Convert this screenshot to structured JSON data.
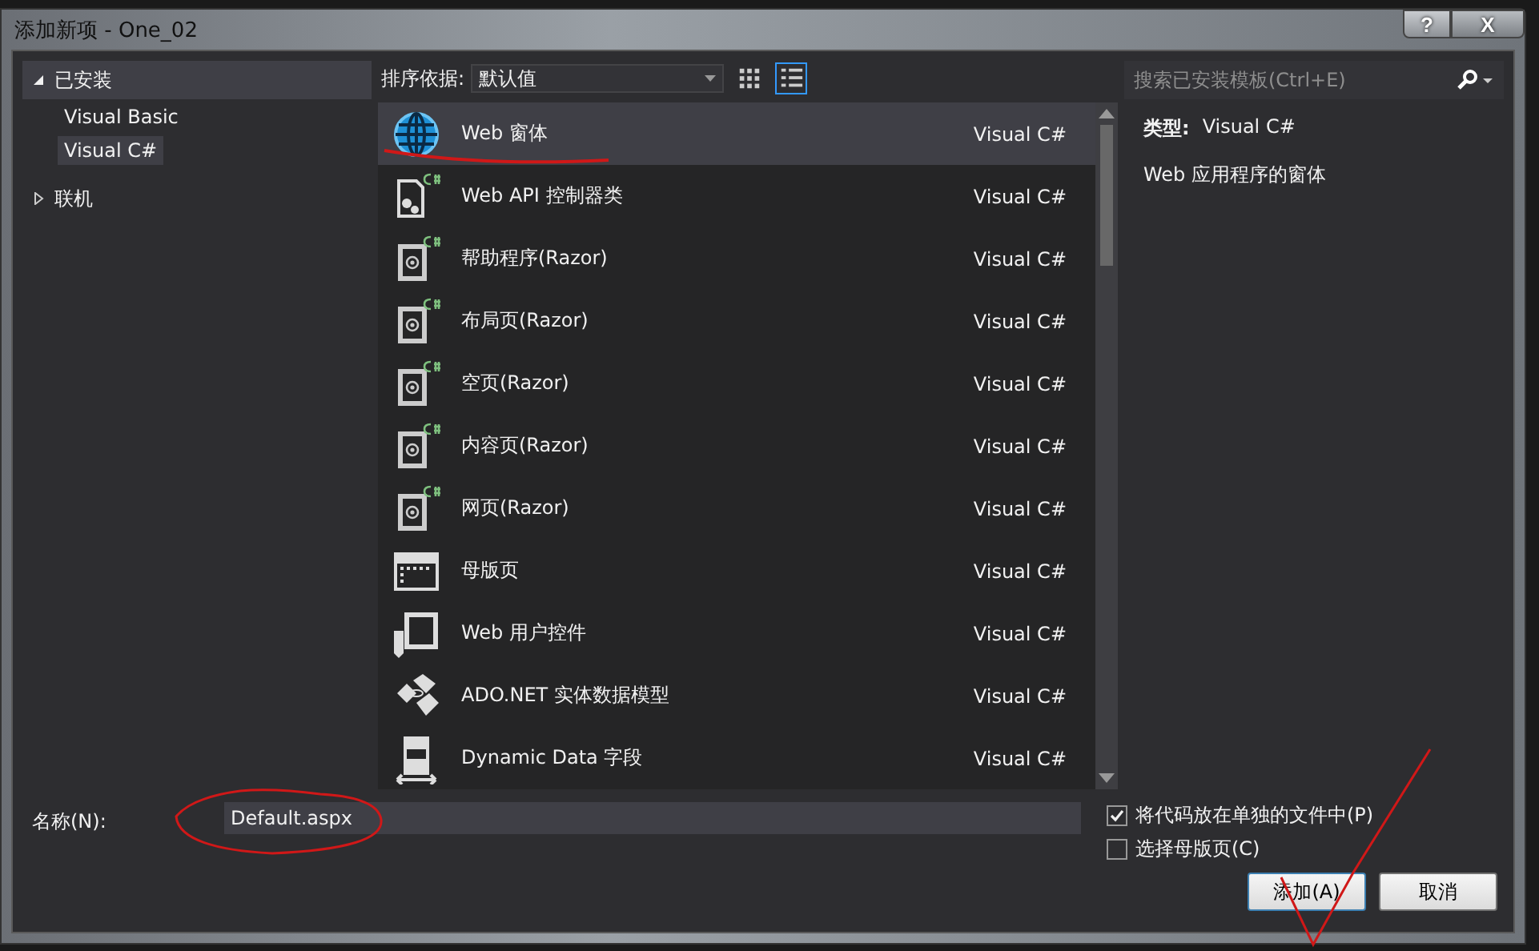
{
  "window": {
    "title": "添加新项 - One_02",
    "buttons": [
      "?",
      "X"
    ]
  },
  "sidebar": {
    "items": [
      {
        "label": "已安装",
        "expanded": true,
        "children": [
          {
            "label": "Visual Basic",
            "selected": false
          },
          {
            "label": "Visual C#",
            "selected": true
          }
        ]
      },
      {
        "label": "联机",
        "expanded": false
      }
    ]
  },
  "toolbar": {
    "sort_label": "排序依据:",
    "sort_value": "默认值",
    "views": [
      {
        "kind": "grid",
        "selected": false
      },
      {
        "kind": "list",
        "selected": true
      }
    ]
  },
  "search": {
    "placeholder": "搜索已安装模板(Ctrl+E)"
  },
  "templates": [
    {
      "kind": "globe",
      "name": "Web 窗体",
      "language": "Visual C#",
      "selected": true
    },
    {
      "kind": "api",
      "name": "Web API 控制器类",
      "language": "Visual C#",
      "selected": false
    },
    {
      "kind": "razor",
      "name": "帮助程序(Razor)",
      "language": "Visual C#",
      "selected": false
    },
    {
      "kind": "razor",
      "name": "布局页(Razor)",
      "language": "Visual C#",
      "selected": false
    },
    {
      "kind": "razor",
      "name": "空页(Razor)",
      "language": "Visual C#",
      "selected": false
    },
    {
      "kind": "razor",
      "name": "内容页(Razor)",
      "language": "Visual C#",
      "selected": false
    },
    {
      "kind": "razor",
      "name": "网页(Razor)",
      "language": "Visual C#",
      "selected": false
    },
    {
      "kind": "master",
      "name": "母版页",
      "language": "Visual C#",
      "selected": false
    },
    {
      "kind": "usercontrol",
      "name": "Web 用户控件",
      "language": "Visual C#",
      "selected": false
    },
    {
      "kind": "ado",
      "name": "ADO.NET 实体数据模型",
      "language": "Visual C#",
      "selected": false
    },
    {
      "kind": "dynamic",
      "name": "Dynamic Data 字段",
      "language": "Visual C#",
      "selected": false
    }
  ],
  "details": {
    "type_label": "类型:",
    "type_value": "Visual C#",
    "description": "Web 应用程序的窗体"
  },
  "name_field": {
    "label": "名称(N):",
    "value": "Default.aspx"
  },
  "options": [
    {
      "label": "将代码放在单独的文件中(P)",
      "checked": true
    },
    {
      "label": "选择母版页(C)",
      "checked": false
    }
  ],
  "buttons": [
    {
      "label": "添加(A)",
      "kind": "primary"
    },
    {
      "label": "取消",
      "kind": "normal"
    }
  ]
}
